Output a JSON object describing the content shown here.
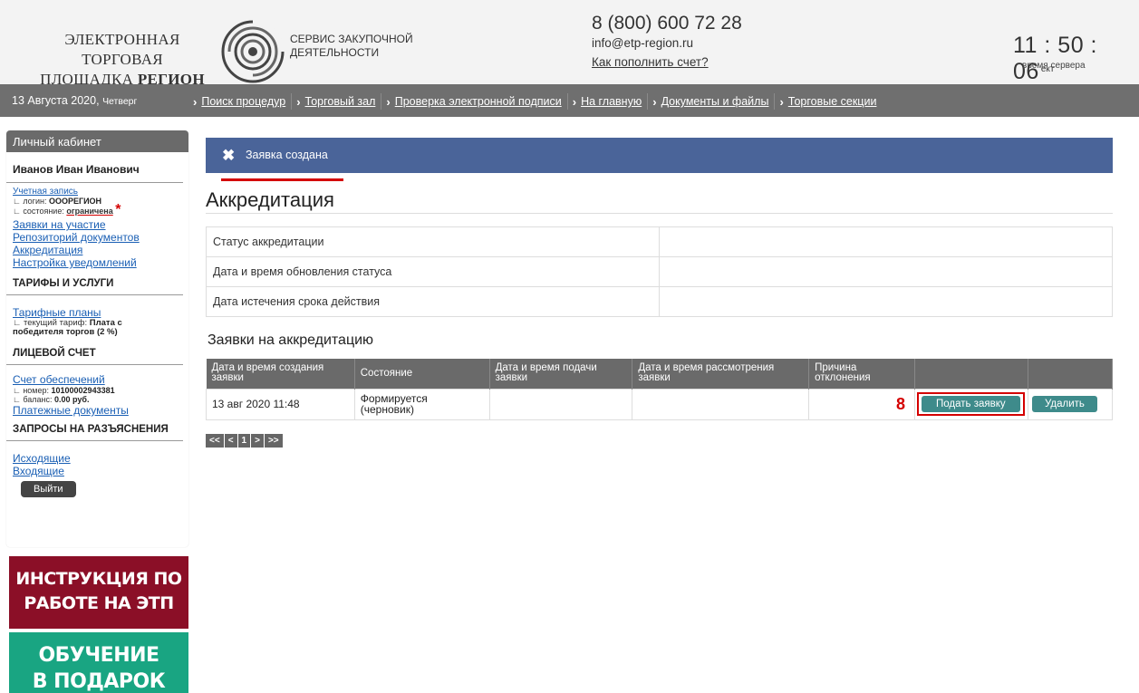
{
  "header": {
    "logo_line1": "ЭЛЕКТРОННАЯ ТОРГОВАЯ",
    "logo_line2_prefix": "ПЛОЩАДКА",
    "logo_line2_bold": "РЕГИОН",
    "service_line1": "СЕРВИС ЗАКУПОЧНОЙ",
    "service_line2": "ДЕЯТЕЛЬНОСТИ",
    "phone": "8 (800) 600 72 28",
    "email": "info@etp-region.ru",
    "topup_link": "Как пополнить счет?",
    "time": "11 : 50 : 06",
    "timezone": "ект",
    "time_label": "время сервера"
  },
  "navbar": {
    "date": "13 Августа 2020,",
    "weekday": "Четверг",
    "links": [
      "Поиск процедур",
      "Торговый зал",
      "Проверка электронной подписи",
      "На главную",
      "Документы и файлы",
      "Торговые секции"
    ]
  },
  "sidebar": {
    "title": "Личный кабинет",
    "user_name": "Иванов Иван Иванович",
    "account_link": "Учетная запись",
    "login_label": "логин:",
    "login_value": "ОООРЕГИОН",
    "state_label": "состояние:",
    "state_value": "ограничена",
    "links1": [
      "Заявки на участие",
      "Репозиторий документов",
      "Аккредитация",
      "Настройка уведомлений"
    ],
    "tariffs_title": "ТАРИФЫ И УСЛУГИ",
    "tariff_link": "Тарифные планы",
    "tariff_current_label": "текущий тариф:",
    "tariff_current_value1": "Плата с",
    "tariff_current_value2": "победителя торгов (2 %)",
    "account_title": "ЛИЦЕВОЙ СЧЕТ",
    "security_link": "Счет обеспечений",
    "number_label": "номер:",
    "number_value": "10100002943381",
    "balance_label": "баланс:",
    "balance_value": "0.00 руб.",
    "payment_link": "Платежные документы",
    "requests_title": "ЗАПРОСЫ НА РАЗЪЯСНЕНИЯ",
    "outgoing_link": "Исходящие",
    "incoming_link": "Входящие",
    "logout_label": "Выйти"
  },
  "banners": {
    "instruction_l1": "ИНСТРУКЦИЯ ПО",
    "instruction_l2": "РАБОТЕ НА ЭТП",
    "training_l1": "ОБУЧЕНИЕ",
    "training_l2": "В ПОДАРОК"
  },
  "main": {
    "alert": "Заявка создана",
    "title": "Аккредитация",
    "status_rows": [
      {
        "label": "Статус аккредитации",
        "value": ""
      },
      {
        "label": "Дата и время обновления статуса",
        "value": ""
      },
      {
        "label": "Дата истечения срока действия",
        "value": ""
      }
    ],
    "apps_title": "Заявки на аккредитацию",
    "columns": [
      "Дата и время создания заявки",
      "Состояние",
      "Дата и время подачи заявки",
      "Дата и время рассмотрения заявки",
      "Причина отклонения"
    ],
    "row": {
      "created": "13 авг 2020 11:48",
      "state1": "Формируется",
      "state2": "(черновик)",
      "submitted": "",
      "reviewed": "",
      "reason": ""
    },
    "step_number": "8",
    "submit_label": "Подать заявку",
    "delete_label": "Удалить",
    "pager": [
      "<<",
      "<",
      "1",
      ">",
      ">>"
    ]
  },
  "colors": {
    "accent_blue": "#4a6499",
    "nav_gray": "#6f6f6f",
    "button_teal": "#3e8b8b",
    "highlight_red": "#d40000",
    "banner_red": "#8b0f27",
    "banner_green": "#19a582"
  }
}
